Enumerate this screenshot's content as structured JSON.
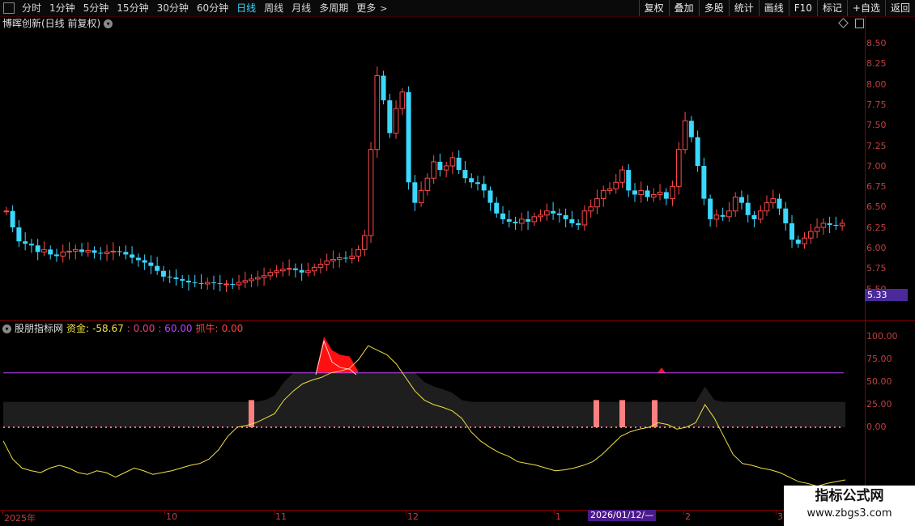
{
  "toolbar": {
    "periods": [
      "分时",
      "1分钟",
      "5分钟",
      "15分钟",
      "30分钟",
      "60分钟",
      "日线",
      "周线",
      "月线",
      "多周期",
      "更多"
    ],
    "active_period": "日线",
    "right_tools": [
      "复权",
      "叠加",
      "多股",
      "统计",
      "画线",
      "F10",
      "标记",
      "+自选",
      "返回"
    ]
  },
  "stock": {
    "title": "博晖创新(日线 前复权)"
  },
  "price_axis": {
    "labels": [
      "8.50",
      "8.25",
      "8.00",
      "7.75",
      "7.50",
      "7.25",
      "7.00",
      "6.75",
      "6.50",
      "6.25",
      "6.00",
      "5.75",
      "5.50"
    ],
    "current_price": "5.33"
  },
  "indicator": {
    "name": "股朋指标网",
    "fund_label": "资金:",
    "fund_value": "-58.67",
    "level1": ": 0.00",
    "level2": ": 60.00",
    "catch_label": "抓牛:",
    "catch_value": "0.00",
    "axis_labels": [
      "100.00",
      "75.00",
      "50.00",
      "25.00",
      "0.00"
    ]
  },
  "time_axis": {
    "labels": [
      "2025年",
      "10",
      "11",
      "12",
      "1",
      "2",
      "3"
    ],
    "cursor_date": "2026/01/12/—"
  },
  "watermark": {
    "line1": "指标公式网",
    "line2": "www.zbgs3.com"
  },
  "colors": {
    "up": "#ff4a4a",
    "down": "#3ad8ff",
    "line_yellow": "#f0e040",
    "purple": "#c040ff",
    "red_fill": "#ff1010",
    "bar_pink": "#ff8080"
  }
}
